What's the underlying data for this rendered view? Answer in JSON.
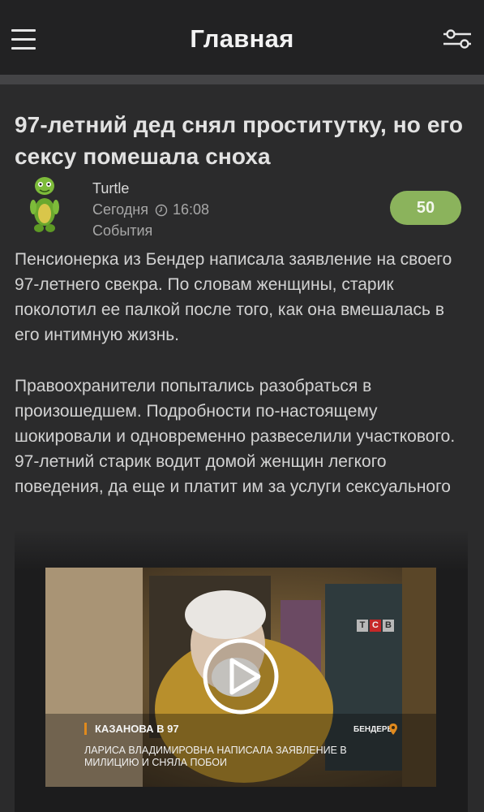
{
  "header": {
    "title": "Главная",
    "menu_icon": "hamburger-menu-icon",
    "filter_icon": "sliders-settings-icon"
  },
  "article": {
    "title": "97-летний дед снял проститутку, но его сексу помешала сноха",
    "author": "Turtle",
    "date": "Сегодня",
    "time": "16:08",
    "category": "События",
    "score": "50",
    "paragraphs": [
      "Пенсионерка из Бендер написала заявление на своего 97-летнего свекра. По словам женщины, старик поколотил ее палкой после того, как она вмешалась в его интимную жизнь.",
      "Правоохранители попытались разобраться в произошедшем. Подробности по-настоящему шокировали и одновременно развеселили участкового. 97-летний старик водит домой женщин легкого поведения, да еще и платит им за услуги сексуального"
    ]
  },
  "video": {
    "channel": [
      "T",
      "C",
      "B"
    ],
    "ticker_title": "КАЗАНОВА В 97",
    "ticker_place": "БЕНДЕРЫ",
    "ticker_desc": "ЛАРИСА ВЛАДИМИРОВНА НАПИСАЛА ЗАЯВЛЕНИЕ В МИЛИЦИЮ И СНЯЛА ПОБОИ",
    "play_icon": "play-icon"
  },
  "colors": {
    "background": "#2b2b2c",
    "topbar": "#222223",
    "score_badge": "#8bb35c",
    "accent_orange": "#e08a1e"
  }
}
